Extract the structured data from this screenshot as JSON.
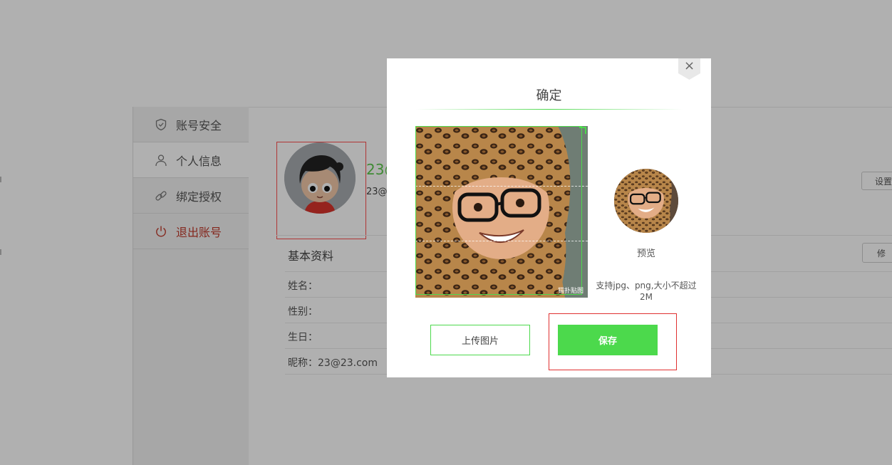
{
  "sidebar": {
    "items": [
      {
        "label": "账号安全",
        "icon": "shield-icon"
      },
      {
        "label": "个人信息",
        "icon": "user-icon"
      },
      {
        "label": "绑定授权",
        "icon": "link-icon"
      },
      {
        "label": "退出账号",
        "icon": "power-icon"
      }
    ]
  },
  "profile": {
    "name_partial": "23@",
    "email_partial": "23@",
    "set_button": "设置",
    "edit_button": "修"
  },
  "basic_info": {
    "title": "基本资料",
    "fields": [
      {
        "label": "姓名："
      },
      {
        "label": "性别："
      },
      {
        "label": "生日："
      },
      {
        "label": "昵称：23@23.com"
      }
    ]
  },
  "modal": {
    "close_symbol": "×",
    "title": "确定",
    "preview_label": "预览",
    "support_text": "支持jpg、png,大小不超过2M",
    "upload_button": "上传图片",
    "save_button": "保存",
    "watermark": "猫扑贴图"
  },
  "colors": {
    "accent": "#4cd94c",
    "highlight_border": "#e03030",
    "logout": "#c0392b"
  }
}
